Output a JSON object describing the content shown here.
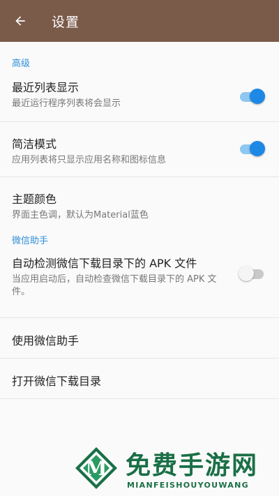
{
  "appbar": {
    "title": "设置",
    "back_icon": "arrow-left-icon",
    "background": "#7a5a49"
  },
  "sections": {
    "advanced": {
      "header": "高级",
      "recent_list": {
        "title": "最近列表显示",
        "summary": "最近运行程序列表将会显示",
        "enabled": true
      },
      "simple_mode": {
        "title": "简洁模式",
        "summary": "应用列表将只显示应用名称和图标信息",
        "enabled": true
      },
      "theme_color": {
        "title": "主题颜色",
        "summary": "界面主色调，默认为Material蓝色"
      }
    },
    "wechat": {
      "header": "微信助手",
      "auto_detect": {
        "title": "自动检测微信下载目录下的 APK 文件",
        "summary": "当应用启动后，自动检查微信下载目录下的 APK 文件。",
        "enabled": false
      },
      "use_assistant": {
        "title": "使用微信助手"
      },
      "open_download_dir": {
        "title": "打开微信下载目录"
      }
    }
  },
  "colors": {
    "accent": "#1e88e5",
    "section_header": "#2f8fd8"
  },
  "watermark": {
    "title": "免费手游网",
    "subtitle": "MIANFEISHOUYOUWANG",
    "logo_letter": "M"
  }
}
